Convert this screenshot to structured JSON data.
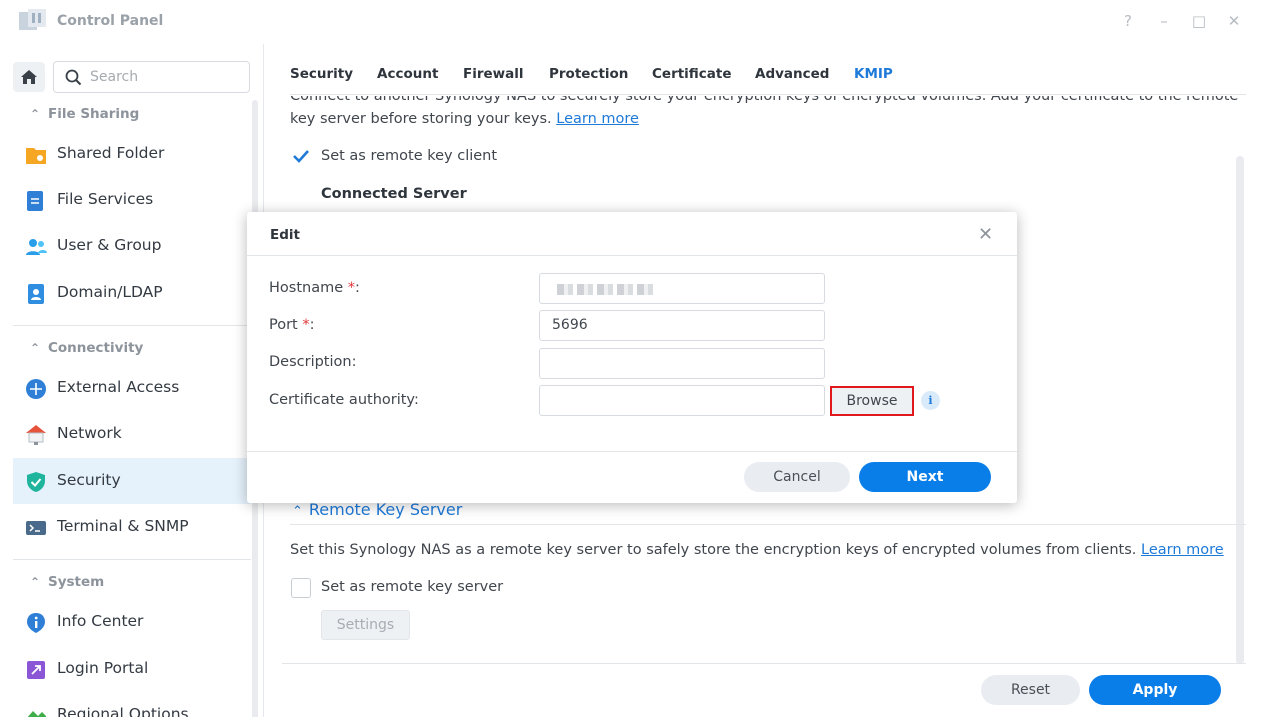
{
  "app": {
    "title": "Control Panel"
  },
  "window_controls": {
    "help": "?",
    "minimize": "–",
    "maximize": "□",
    "close": "✕"
  },
  "sidebar": {
    "search_placeholder": "Search",
    "sections": [
      {
        "label": "File Sharing",
        "items": [
          {
            "label": "Shared Folder",
            "icon": "folder-icon"
          },
          {
            "label": "File Services",
            "icon": "file-services-icon"
          },
          {
            "label": "User & Group",
            "icon": "user-group-icon"
          },
          {
            "label": "Domain/LDAP",
            "icon": "domain-icon"
          }
        ]
      },
      {
        "label": "Connectivity",
        "items": [
          {
            "label": "External Access",
            "icon": "external-access-icon"
          },
          {
            "label": "Network",
            "icon": "network-icon"
          },
          {
            "label": "Security",
            "icon": "shield-icon",
            "active": true
          },
          {
            "label": "Terminal & SNMP",
            "icon": "terminal-icon"
          }
        ]
      },
      {
        "label": "System",
        "items": [
          {
            "label": "Info Center",
            "icon": "info-center-icon"
          },
          {
            "label": "Login Portal",
            "icon": "login-portal-icon"
          },
          {
            "label": "Regional Options",
            "icon": "regional-options-icon"
          }
        ]
      }
    ]
  },
  "tabs": [
    "Security",
    "Account",
    "Firewall",
    "Protection",
    "Certificate",
    "Advanced",
    "KMIP"
  ],
  "active_tab": "KMIP",
  "client": {
    "description_line1": "Connect to another Synology NAS to securely store your encryption keys of encrypted volumes. Add your certificate to the remote",
    "description_line2": "key server before storing your keys.",
    "learn_more": "Learn more",
    "checkbox_label": "Set as remote key client",
    "checked": true,
    "connected_server_heading": "Connected Server"
  },
  "server": {
    "section_title": "Remote Key Server",
    "description": "Set this Synology NAS as a remote key server to safely store the encryption keys of encrypted volumes from clients.",
    "learn_more": "Learn more",
    "checkbox_label": "Set as remote key server",
    "checked": false,
    "settings_button": "Settings"
  },
  "footer": {
    "reset": "Reset",
    "apply": "Apply"
  },
  "dialog": {
    "title": "Edit",
    "close": "✕",
    "required_mark": "*",
    "fields": {
      "hostname_label": "Hostname ",
      "port_label": "Port ",
      "port_value": "5696",
      "description_label": "Description:",
      "description_value": "",
      "ca_label": "Certificate authority:",
      "ca_value": ""
    },
    "browse": "Browse",
    "info": "i",
    "cancel": "Cancel",
    "next": "Next"
  },
  "colors": {
    "accent": "#0a7ee8",
    "highlight_border": "#e0171b",
    "active_nav_bg": "#e5f1fb"
  }
}
